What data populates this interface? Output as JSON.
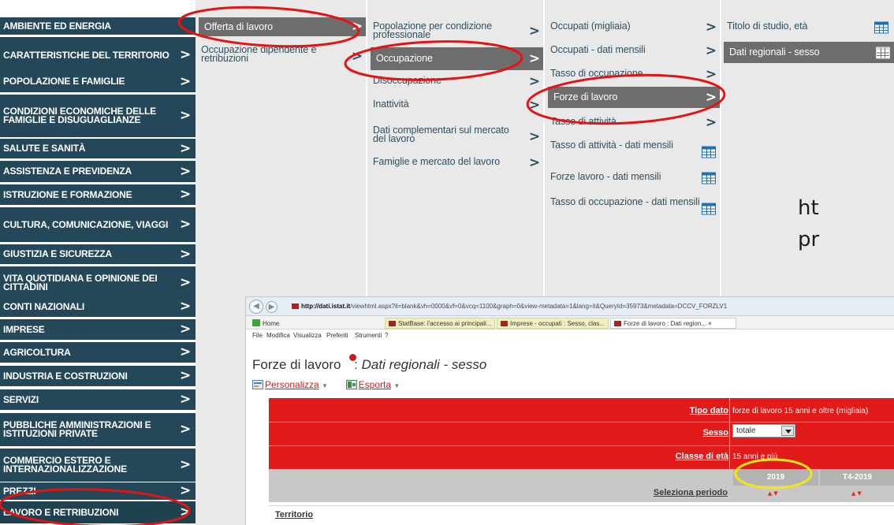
{
  "menu": {
    "themes": [
      "AMBIENTE ED ENERGIA",
      "CARATTERISTICHE DEL TERRITORIO",
      "POPOLAZIONE E FAMIGLIE",
      "CONDIZIONI ECONOMICHE DELLE FAMIGLIE E DISUGUAGLIANZE",
      "SALUTE E SANITÀ",
      "ASSISTENZA E PREVIDENZA",
      "ISTRUZIONE E FORMAZIONE",
      "CULTURA, COMUNICAZIONE, VIAGGI",
      "GIUSTIZIA E SICUREZZA",
      "VITA QUOTIDIANA E OPINIONE DEI CITTADINI",
      "CONTI NAZIONALI",
      "IMPRESE",
      "AGRICOLTURA",
      "INDUSTRIA E COSTRUZIONI",
      "SERVIZI",
      "PUBBLICHE AMMINISTRAZIONI E ISTITUZIONI PRIVATE",
      "COMMERCIO ESTERO E INTERNAZIONALIZZAZIONE",
      "PREZZI",
      "LAVORO E RETRIBUZIONI"
    ],
    "col2": [
      "Offerta di lavoro",
      "Occupazione dipendente e retribuzioni"
    ],
    "col3": [
      "Popolazione per condizione professionale",
      "Occupazione",
      "Disoccupazione",
      "Inattività",
      "Dati complementari sul mercato del lavoro",
      "Famiglie e mercato del lavoro"
    ],
    "col4": [
      "Occupati (migliaia)",
      "Occupati - dati mensili",
      "Tasso di occupazione",
      "Forze di lavoro",
      "Tasso di attività",
      "Tasso di attività - dati mensili",
      "Forze lavoro - dati mensili",
      "Tasso di occupazione - dati mensili"
    ],
    "col5": [
      "Titolo di studio, età",
      "Dati regionali - sesso"
    ],
    "chevron": ">"
  },
  "url_fragment": "ht\npr",
  "browser": {
    "url_host": "http://dati.istat.it",
    "url_rest": "/viewhtml.aspx?il=blank&vh=0000&vf=0&vcq=1100&graph=0&view-metadata=1&lang=it&QueryId=35973&metadata=DCCV_FORZLV1",
    "tabs": [
      "Home",
      "StatBase: l'accesso ai principali...",
      "Imprese - occupati : Sesso, clas...",
      "Forze di lavoro : Dati region...  ×"
    ],
    "menu": [
      "File",
      "Modifica",
      "Visualizza",
      "Preferiti",
      "Strumenti",
      "?"
    ],
    "title_main": "Forze di lavoro",
    "title_sep": " : ",
    "title_sub": "Dati regionali - sesso",
    "toolbar": [
      "Personalizza",
      "Esporta"
    ],
    "filters": {
      "tipo_label": "Tipo dato",
      "tipo_value": "forze di lavoro 15 anni e oltre (migliaia)",
      "sesso_label": "Sesso",
      "sesso_value": "totale",
      "eta_label": "Classe di età",
      "eta_value": "15 anni e più",
      "period_label": "Seleziona periodo"
    },
    "periods": [
      "2019",
      "T4-2019"
    ],
    "sort_glyph": "▲▼",
    "row_header": "Territorio"
  },
  "colors": {
    "theme_bg": "#24485a",
    "column_bg": "#e9e9e9",
    "active_item_bg": "#6d6d6d",
    "istat_red": "#e11a1a",
    "annotation_red": "#e41414",
    "annotation_yellow": "#f2e616",
    "grid_icon_blue": "#1f6fb2"
  }
}
